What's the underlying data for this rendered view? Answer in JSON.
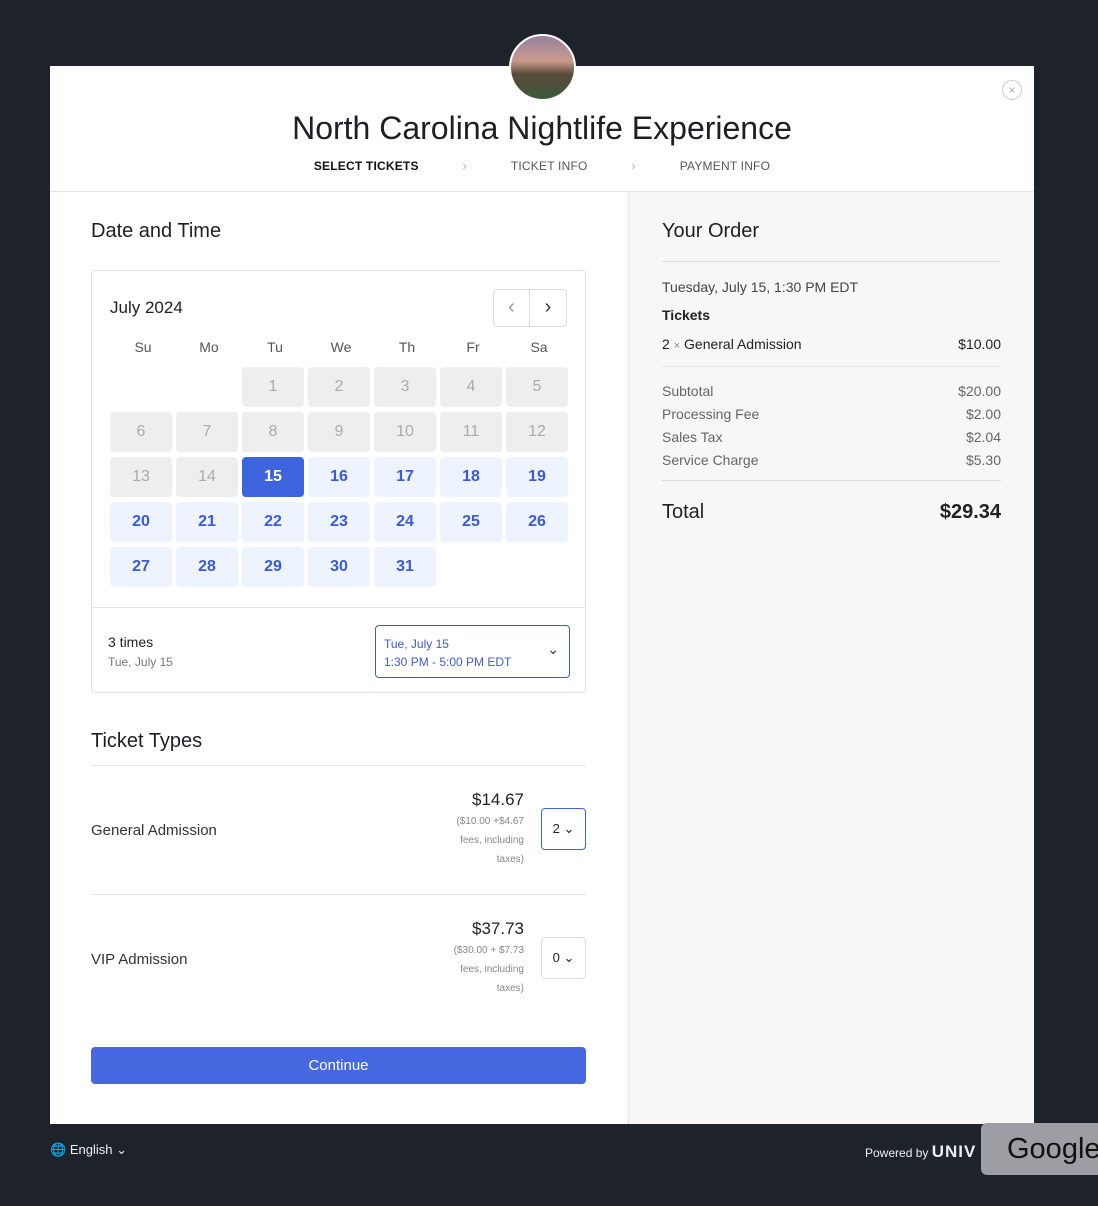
{
  "header": {
    "title": "North Carolina Nightlife Experience",
    "steps": [
      "SELECT TICKETS",
      "TICKET INFO",
      "PAYMENT INFO"
    ],
    "step_sep": "›",
    "close_icon": "×"
  },
  "date_time": {
    "heading": "Date and Time",
    "month": "July 2024",
    "prev": "‹",
    "next": "›",
    "weekdays": [
      "Su",
      "Mo",
      "Tu",
      "We",
      "Th",
      "Fr",
      "Sa"
    ],
    "first_weekday": 2,
    "days_in_month": 31,
    "disabled_through": 14,
    "selected_day": 15,
    "times_count": "3 times",
    "times_date": "Tue, July 15",
    "time_select": {
      "line1": "Tue, July 15",
      "line2": "1:30 PM - 5:00 PM EDT"
    }
  },
  "ticket_types": {
    "heading": "Ticket Types",
    "items": [
      {
        "name": "General Admission",
        "price": "$14.67",
        "fees": "($10.00 +$4.67 fees, including taxes)",
        "qty": "2"
      },
      {
        "name": "VIP Admission",
        "price": "$37.73",
        "fees": "($30.00 + $7.73 fees, including taxes)",
        "qty": "0"
      }
    ]
  },
  "continue_label": "Continue",
  "order": {
    "heading": "Your Order",
    "date": "Tuesday, July 15, 1:30 PM EDT",
    "tickets_label": "Tickets",
    "line": {
      "qty": "2",
      "x": "×",
      "name": "General Admission",
      "amount": "$10.00"
    },
    "fees": [
      {
        "label": "Subtotal",
        "amount": "$20.00"
      },
      {
        "label": "Processing Fee",
        "amount": "$2.00"
      },
      {
        "label": "Sales Tax",
        "amount": "$2.04"
      },
      {
        "label": "Service Charge",
        "amount": "$5.30"
      }
    ],
    "total_label": "Total",
    "total": "$29.34"
  },
  "footer": {
    "language": "English",
    "powered_by": "Powered by",
    "brand": "UNIV",
    "google": "Google"
  },
  "colors": {
    "accent": "#3d63dd",
    "available_bg": "#edf3ff",
    "disabled_bg": "#eeeeee"
  }
}
